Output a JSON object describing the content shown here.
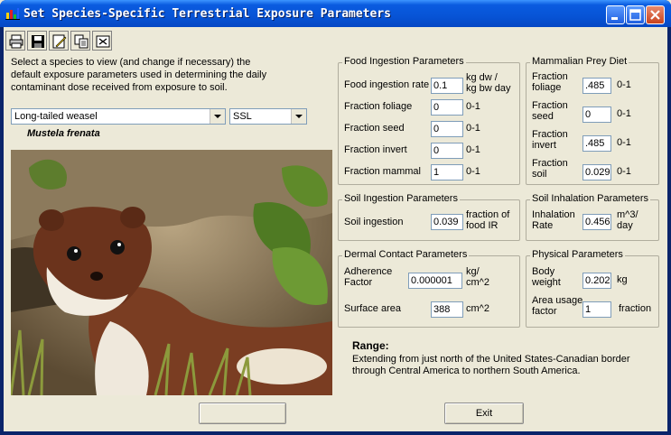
{
  "window": {
    "title": "Set Species-Specific Terrestrial Exposure Parameters"
  },
  "toolbar": {
    "icons": [
      "printer-icon",
      "save-icon",
      "edit-icon",
      "copy-icon",
      "clear-icon"
    ]
  },
  "instructions": "Select a species to view (and change if necessary) the default exposure parameters used in determining the daily contaminant dose received from exposure to soil.",
  "species_select": {
    "value": "Long-tailed weasel"
  },
  "type_select": {
    "value": "SSL"
  },
  "scientific_name": "Mustela frenata",
  "food_ingestion": {
    "title": "Food Ingestion Parameters",
    "rows": [
      {
        "label": "Food ingestion rate",
        "value": "0.1",
        "unit": "kg dw /\nkg bw day"
      },
      {
        "label": "Fraction foliage",
        "value": "0",
        "unit": "0-1"
      },
      {
        "label": "Fraction seed",
        "value": "0",
        "unit": "0-1"
      },
      {
        "label": "Fraction invert",
        "value": "0",
        "unit": "0-1"
      },
      {
        "label": "Fraction mammal",
        "value": "1",
        "unit": "0-1"
      }
    ]
  },
  "prey_diet": {
    "title": "Mammalian Prey Diet",
    "rows": [
      {
        "label": "Fraction\nfoliage",
        "value": ".485",
        "unit": "0-1"
      },
      {
        "label": "Fraction\nseed",
        "value": "0",
        "unit": "0-1"
      },
      {
        "label": "Fraction\ninvert",
        "value": ".485",
        "unit": "0-1"
      },
      {
        "label": "Fraction\nsoil",
        "value": "0.029",
        "unit": "0-1"
      }
    ]
  },
  "soil_ingestion": {
    "title": "Soil Ingestion Parameters",
    "label": "Soil ingestion",
    "value": "0.039",
    "unit": "fraction of\nfood IR"
  },
  "soil_inhalation": {
    "title": "Soil Inhalation Parameters",
    "label": "Inhalation\nRate",
    "value": "0.456",
    "unit": "m^3/\nday"
  },
  "dermal": {
    "title": "Dermal Contact Parameters",
    "adherence_label": "Adherence\nFactor",
    "adherence_value": "0.000001",
    "adherence_unit": "kg/\ncm^2",
    "surface_label": "Surface area",
    "surface_value": "388",
    "surface_unit": "cm^2"
  },
  "physical": {
    "title": "Physical Parameters",
    "weight_label": "Body\nweight",
    "weight_value": "0.202",
    "weight_unit": "kg",
    "area_label": "Area usage\nfactor",
    "area_value": "1",
    "area_unit": "fraction"
  },
  "range": {
    "title": "Range:",
    "text": "Extending from just north of the United States-Canadian border through Central America to northern South America."
  },
  "buttons": {
    "left_label": "",
    "exit_label": "Exit"
  }
}
